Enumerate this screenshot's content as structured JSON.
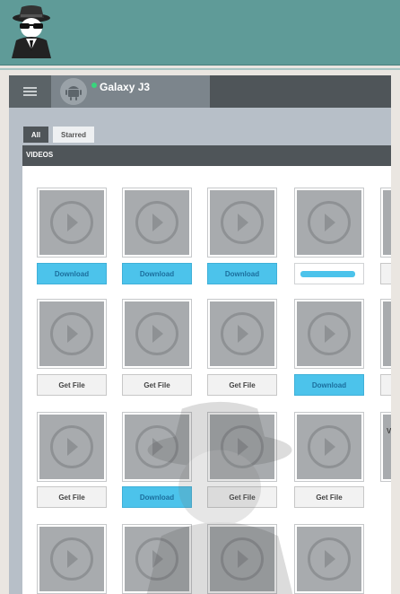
{
  "device": {
    "name": "Galaxy J3"
  },
  "filters": {
    "all": "All",
    "starred": "Starred"
  },
  "section": {
    "title": "VIDEOS"
  },
  "colors": {
    "header": "#5f9b98",
    "dark": "#4f5559",
    "accent": "#4cc3eb"
  },
  "icons": {
    "logo": "spy-logo-icon",
    "menu": "hamburger-menu-icon",
    "device": "android-icon",
    "thumb": "play-icon"
  },
  "videos": [
    {
      "action": "Download",
      "state": "download"
    },
    {
      "action": "Download",
      "state": "download"
    },
    {
      "action": "Download",
      "state": "download"
    },
    {
      "action": "",
      "state": "progress",
      "progress": 0.95
    },
    {
      "action": "",
      "state": "partial"
    },
    {
      "action": "Get File",
      "state": "getfile"
    },
    {
      "action": "Get File",
      "state": "getfile"
    },
    {
      "action": "Get File",
      "state": "getfile"
    },
    {
      "action": "Download",
      "state": "download"
    },
    {
      "action": "",
      "state": "partial"
    },
    {
      "action": "Get File",
      "state": "getfile"
    },
    {
      "action": "Download",
      "state": "download"
    },
    {
      "action": "Get File",
      "state": "getfile"
    },
    {
      "action": "Get File",
      "state": "getfile"
    },
    {
      "action": "V",
      "state": "partial-text"
    },
    {
      "action": "",
      "state": "thumb-only"
    },
    {
      "action": "",
      "state": "thumb-only"
    },
    {
      "action": "",
      "state": "thumb-only"
    },
    {
      "action": "",
      "state": "thumb-only"
    }
  ]
}
